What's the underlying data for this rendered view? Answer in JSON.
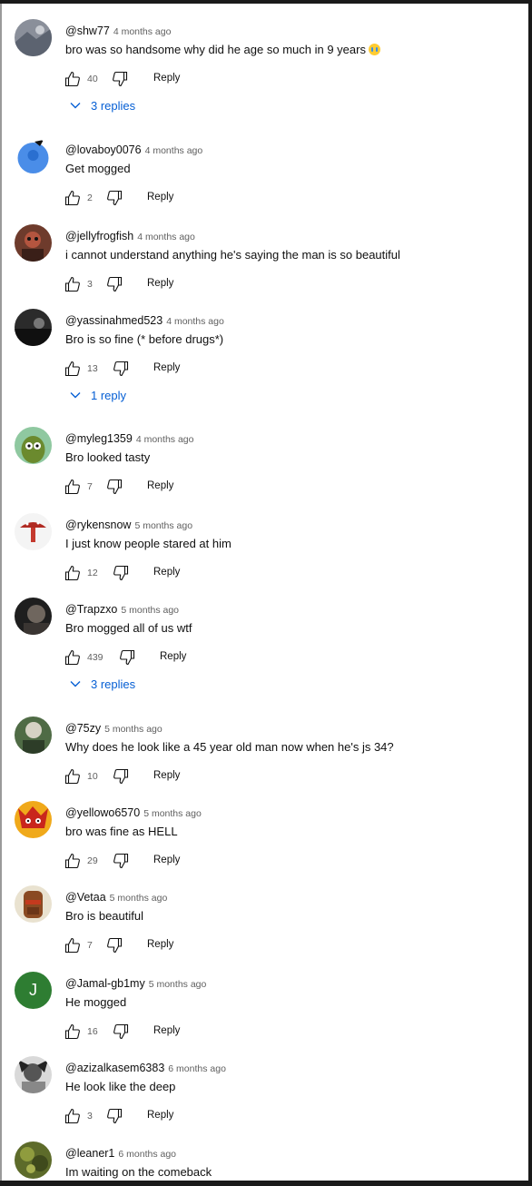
{
  "reply_label": "Reply",
  "comments": [
    {
      "author": "@shw77",
      "time": "4 months ago",
      "text": "bro was so handsome why did he age so much in 9 years",
      "emoji": "loudly-crying-face",
      "likes": "40",
      "replies": "3 replies"
    },
    {
      "author": "@lovaboy0076",
      "time": "4 months ago",
      "text": "Get mogged",
      "likes": "2",
      "replies": ""
    },
    {
      "author": "@jellyfrogfish",
      "time": "4 months ago",
      "text": "i cannot understand anything he's saying the man is so beautiful",
      "likes": "3",
      "replies": ""
    },
    {
      "author": "@yassinahmed523",
      "time": "4 months ago",
      "text": "Bro is so fine (* before drugs*)",
      "likes": "13",
      "replies": "1 reply"
    },
    {
      "author": "@myleg1359",
      "time": "4 months ago",
      "text": "Bro looked tasty",
      "likes": "7",
      "replies": ""
    },
    {
      "author": "@rykensnow",
      "time": "5 months ago",
      "text": "I just know people stared at him",
      "likes": "12",
      "replies": ""
    },
    {
      "author": "@Trapzxo",
      "time": "5 months ago",
      "text": "Bro mogged all of us wtf",
      "likes": "439",
      "replies": "3 replies"
    },
    {
      "author": "@75zy",
      "time": "5 months ago",
      "text": "Why does he look like a 45 year old man now when he's js 34?",
      "likes": "10",
      "replies": ""
    },
    {
      "author": "@yellowo6570",
      "time": "5 months ago",
      "text": "bro was fine as HELL",
      "likes": "29",
      "replies": ""
    },
    {
      "author": "@Vetaa",
      "time": "5 months ago",
      "text": "Bro is beautiful",
      "likes": "7",
      "replies": ""
    },
    {
      "author": "@Jamal-gb1my",
      "time": "5 months ago",
      "text": "He mogged",
      "likes": "16",
      "replies": "",
      "avatar_initial": "J"
    },
    {
      "author": "@azizalkasem6383",
      "time": "6 months ago",
      "text": "He look like the deep",
      "likes": "3",
      "replies": ""
    },
    {
      "author": "@leaner1",
      "time": "6 months ago",
      "text": "Im waiting on the comeback",
      "likes": "",
      "replies": ""
    }
  ],
  "colors": {
    "link": "#065fd4",
    "muted": "#606060",
    "text": "#0f0f0f"
  }
}
